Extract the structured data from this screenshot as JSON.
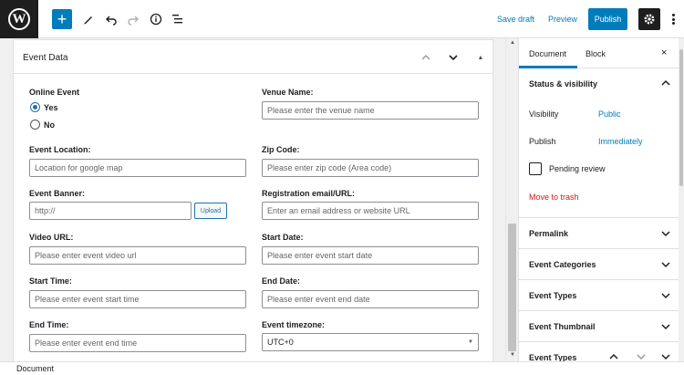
{
  "toolbar": {
    "add_label": "+",
    "save_draft": "Save draft",
    "preview": "Preview",
    "publish": "Publish"
  },
  "metabox": {
    "title": "Event Data",
    "online_event": {
      "label": "Online Event",
      "options": [
        "Yes",
        "No"
      ],
      "selected": "Yes"
    },
    "venue_name": {
      "label": "Venue Name:",
      "placeholder": "Please enter the venue name"
    },
    "event_location": {
      "label": "Event Location:",
      "placeholder": "Location for google map"
    },
    "zip_code": {
      "label": "Zip Code:",
      "placeholder": "Please enter zip code (Area code)"
    },
    "event_banner": {
      "label": "Event Banner:",
      "value": "http://",
      "upload": "Upload"
    },
    "registration": {
      "label": "Registration email/URL:",
      "placeholder": "Enter an email address or website URL"
    },
    "video_url": {
      "label": "Video URL:",
      "placeholder": "Please enter event video url"
    },
    "start_date": {
      "label": "Start Date:",
      "placeholder": "Please enter event start date"
    },
    "start_time": {
      "label": "Start Time:",
      "placeholder": "Please enter event start time"
    },
    "end_date": {
      "label": "End Date:",
      "placeholder": "Please enter event end date"
    },
    "end_time": {
      "label": "End Time:",
      "placeholder": "Please enter event end time"
    },
    "timezone": {
      "label": "Event timezone:",
      "value": "UTC+0"
    }
  },
  "sidebar": {
    "tabs": [
      "Document",
      "Block"
    ],
    "active_tab": "Document",
    "close": "×",
    "status": {
      "title": "Status & visibility",
      "visibility_label": "Visibility",
      "visibility_value": "Public",
      "publish_label": "Publish",
      "publish_value": "Immediately",
      "pending": "Pending review",
      "trash": "Move to trash"
    },
    "panels": [
      "Permalink",
      "Event Categories",
      "Event Types",
      "Event Thumbnail",
      "Event Types"
    ]
  },
  "footer": {
    "breadcrumb": "Document"
  },
  "colors": {
    "accent": "#007cba",
    "danger": "#cc1818",
    "dark": "#1e1e1e"
  }
}
